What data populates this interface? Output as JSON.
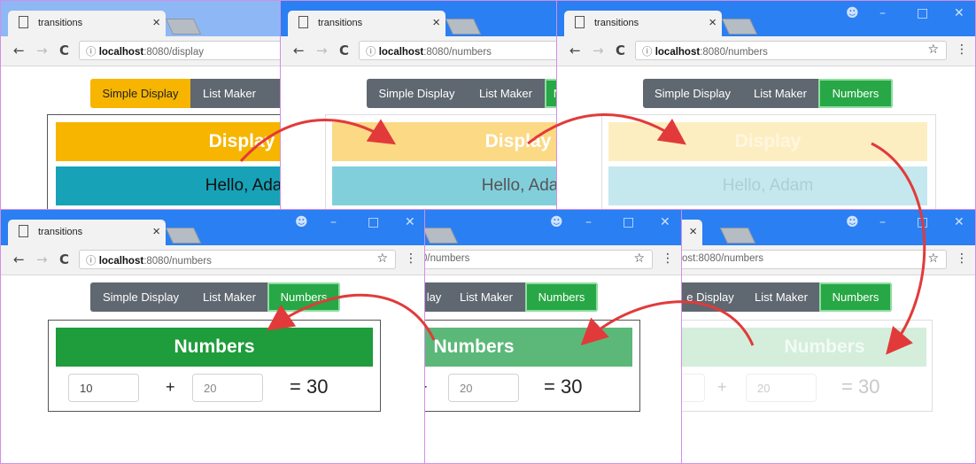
{
  "browser": {
    "tab_title": "transitions",
    "close_glyph": "×",
    "url_host": "localhost",
    "url_port": ":8080",
    "url_path_display": "/display",
    "url_path_numbers": "/numbers",
    "url_partial_1": "0/numbers",
    "url_partial_2": "ost:8080/numbers",
    "info_glyph": "ⓘ",
    "back_glyph": "←",
    "forward_glyph": "→",
    "reload_glyph": "C",
    "star_glyph": "☆",
    "menu_glyph": "⋮",
    "profile_glyph": "☻",
    "minimize_glyph": "–",
    "maximize_glyph": "□",
    "window_close_glyph": "✕"
  },
  "nav": {
    "simple_display": "Simple Display",
    "list_maker": "List Maker",
    "numbers": "Numbers",
    "simple_display_cut_1": "e Display",
    "simple_display_cut_2": "lay",
    "numbers_cut": "N",
    "numbers_cut_2": "I",
    "numbers_overlapped": "Numbers"
  },
  "display": {
    "title": "Display",
    "greeting": "Hello, Adam"
  },
  "numbers": {
    "title": "Numbers",
    "first": "10",
    "second": "20",
    "plus": "+",
    "result": "= 30"
  },
  "colors": {
    "browser_blue": "#2a7ff2",
    "warning": "#f7b500",
    "info": "#17a2b8",
    "success": "#27a745",
    "secondary": "#5f6770",
    "arrow": "#e23a3a"
  }
}
